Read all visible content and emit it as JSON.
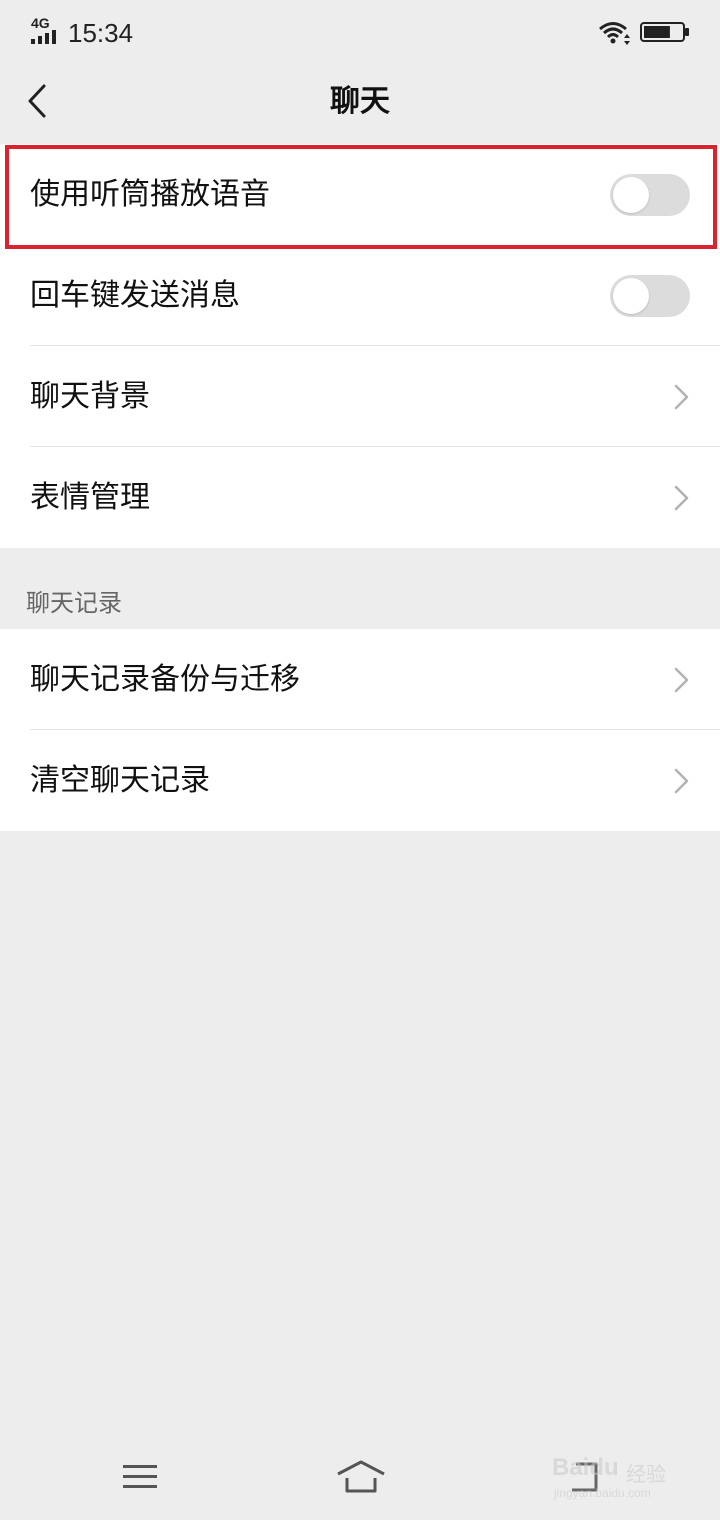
{
  "status_bar": {
    "network": "4G",
    "time": "15:34",
    "battery_level": 0.7
  },
  "header": {
    "title": "聊天",
    "back_icon": "chevron-left-icon"
  },
  "settings_group_1": {
    "items": [
      {
        "label": "使用听筒播放语音",
        "control": "toggle",
        "on": false
      },
      {
        "label": "回车键发送消息",
        "control": "toggle",
        "on": false
      },
      {
        "label": "聊天背景",
        "control": "chevron"
      },
      {
        "label": "表情管理",
        "control": "chevron"
      }
    ]
  },
  "section_header": "聊天记录",
  "settings_group_2": {
    "items": [
      {
        "label": "聊天记录备份与迁移",
        "control": "chevron"
      },
      {
        "label": "清空聊天记录",
        "control": "chevron"
      }
    ]
  },
  "watermark": {
    "brand": "Baidu",
    "sub": "经验",
    "url": "jingyan.baidu.com"
  },
  "colors": {
    "background": "#ededed",
    "card": "#ffffff",
    "highlight_border": "#d9242f",
    "toggle_off": "#dcdcdc"
  }
}
